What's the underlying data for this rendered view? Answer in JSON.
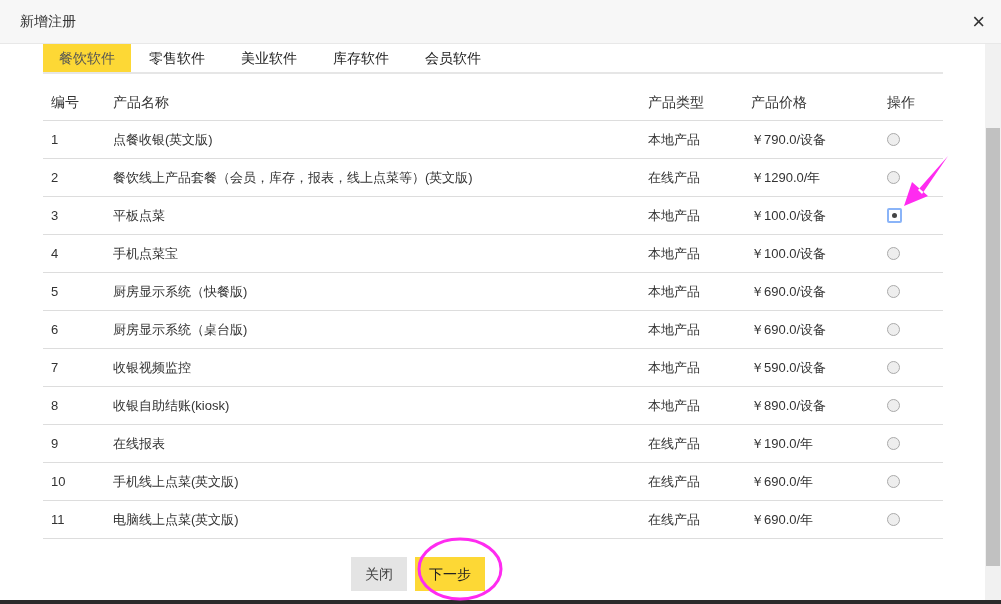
{
  "window": {
    "title": "新增注册",
    "close": "×"
  },
  "tabs": [
    {
      "label": "餐饮软件",
      "selected": true
    },
    {
      "label": "零售软件",
      "selected": false
    },
    {
      "label": "美业软件",
      "selected": false
    },
    {
      "label": "库存软件",
      "selected": false
    },
    {
      "label": "会员软件",
      "selected": false
    }
  ],
  "table": {
    "columns": [
      "编号",
      "产品名称",
      "产品类型",
      "产品价格",
      "操作"
    ],
    "rows": [
      {
        "no": "1",
        "name": "点餐收银(英文版)",
        "type": "本地产品",
        "price": "￥790.0/设备",
        "selected": false
      },
      {
        "no": "2",
        "name": "餐饮线上产品套餐（会员，库存，报表，线上点菜等）(英文版)",
        "type": "在线产品",
        "price": "￥1290.0/年",
        "selected": false
      },
      {
        "no": "3",
        "name": "平板点菜",
        "type": "本地产品",
        "price": "￥100.0/设备",
        "selected": true
      },
      {
        "no": "4",
        "name": "手机点菜宝",
        "type": "本地产品",
        "price": "￥100.0/设备",
        "selected": false
      },
      {
        "no": "5",
        "name": "厨房显示系统（快餐版)",
        "type": "本地产品",
        "price": "￥690.0/设备",
        "selected": false
      },
      {
        "no": "6",
        "name": "厨房显示系统（桌台版)",
        "type": "本地产品",
        "price": "￥690.0/设备",
        "selected": false
      },
      {
        "no": "7",
        "name": "收银视频监控",
        "type": "本地产品",
        "price": "￥590.0/设备",
        "selected": false
      },
      {
        "no": "8",
        "name": "收银自助结账(kiosk)",
        "type": "本地产品",
        "price": "￥890.0/设备",
        "selected": false
      },
      {
        "no": "9",
        "name": "在线报表",
        "type": "在线产品",
        "price": "￥190.0/年",
        "selected": false
      },
      {
        "no": "10",
        "name": "手机线上点菜(英文版)",
        "type": "在线产品",
        "price": "￥690.0/年",
        "selected": false
      },
      {
        "no": "11",
        "name": "电脑线上点菜(英文版)",
        "type": "在线产品",
        "price": "￥690.0/年",
        "selected": false
      }
    ]
  },
  "buttons": [
    {
      "label": "关闭",
      "kind": "secondary"
    },
    {
      "label": "下一步",
      "kind": "primary"
    }
  ]
}
